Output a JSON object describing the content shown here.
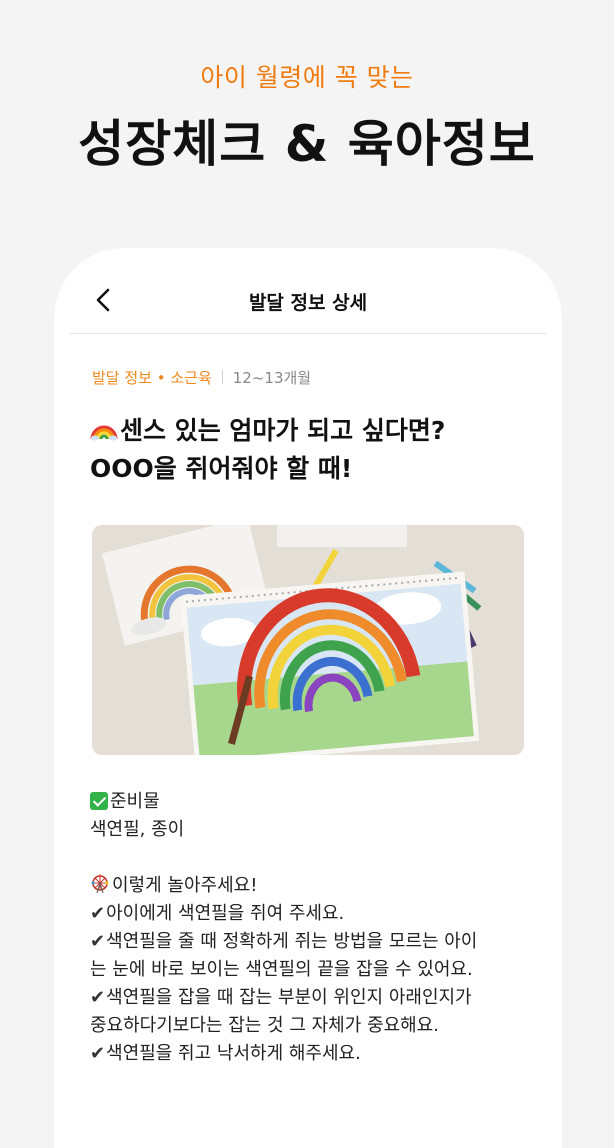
{
  "promo": {
    "subtitle": "아이 월령에 꼭 맞는",
    "title": "성장체크 & 육아정보"
  },
  "navbar": {
    "title": "발달 정보 상세",
    "back_icon": "chevron-left-icon"
  },
  "article": {
    "category": "발달 정보 • 소근육",
    "age": "12~13개월",
    "title_line1": "센스 있는 엄마가 되고 싶다면?",
    "title_line2": "OOO을 쥐어줘야 할 때!",
    "title_icon": "rainbow-emoji",
    "image_description_icon": "rainbow-drawing-photo",
    "body": {
      "materials_heading": "준비물",
      "materials": "색연필, 종이",
      "howto_heading": "이렇게 놀아주세요!",
      "steps": [
        "아이에게 색연필을 쥐여 주세요.",
        "색연필을 줄 때 정확하게 쥐는 방법을 모르는 아이",
        "는 눈에 바로 보이는 색연필의 끝을 잡을 수 있어요.",
        "색연필을 잡을 때 잡는 부분이 위인지 아래인지가",
        "중요하다기보다는 잡는 것 그 자체가 중요해요.",
        "색연필을 쥐고 낙서하게 해주세요."
      ],
      "tick_mark": "✔"
    }
  },
  "colors": {
    "accent": "#f07c10",
    "background": "#f4f4f4",
    "card": "#ffffff"
  }
}
